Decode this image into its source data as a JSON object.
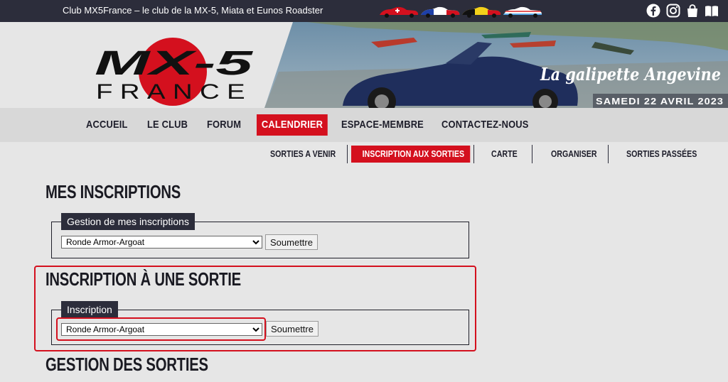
{
  "topbar": {
    "title": "Club MX5France – le club de la MX-5, Miata et Eunos Roadster"
  },
  "social_icons": [
    "facebook-icon",
    "instagram-icon",
    "shop-bag-icon",
    "book-icon"
  ],
  "logo": {
    "line1": "MX-5",
    "line2": "FRANCE"
  },
  "banner": {
    "title": "La galipette Angevine",
    "date": "SAMEDI 22 AVRIL 2023"
  },
  "main_nav": {
    "items": [
      "ACCUEIL",
      "LE CLUB",
      "FORUM",
      "CALENDRIER",
      "ESPACE-MEMBRE",
      "CONTACTEZ-NOUS"
    ],
    "active": "CALENDRIER"
  },
  "sub_nav": {
    "items": [
      "SORTIES A VENIR",
      "INSCRIPTION AUX SORTIES",
      "CARTE",
      "ORGANISER",
      "SORTIES PASSÉES"
    ],
    "active": "INSCRIPTION AUX SORTIES"
  },
  "sections": {
    "mes_inscriptions": {
      "heading": "MES INSCRIPTIONS",
      "legend": "Gestion de mes inscriptions",
      "selected": "Ronde Armor-Argoat",
      "button": "Soumettre"
    },
    "inscription": {
      "heading": "INSCRIPTION À UNE SORTIE",
      "legend": "Inscription",
      "selected": "Ronde Armor-Argoat",
      "button": "Soumettre"
    },
    "gestion": {
      "heading": "GESTION DES SORTIES"
    }
  },
  "colors": {
    "accent": "#d4101e",
    "dark": "#2c2d3b",
    "background": "#e6e6e6"
  }
}
